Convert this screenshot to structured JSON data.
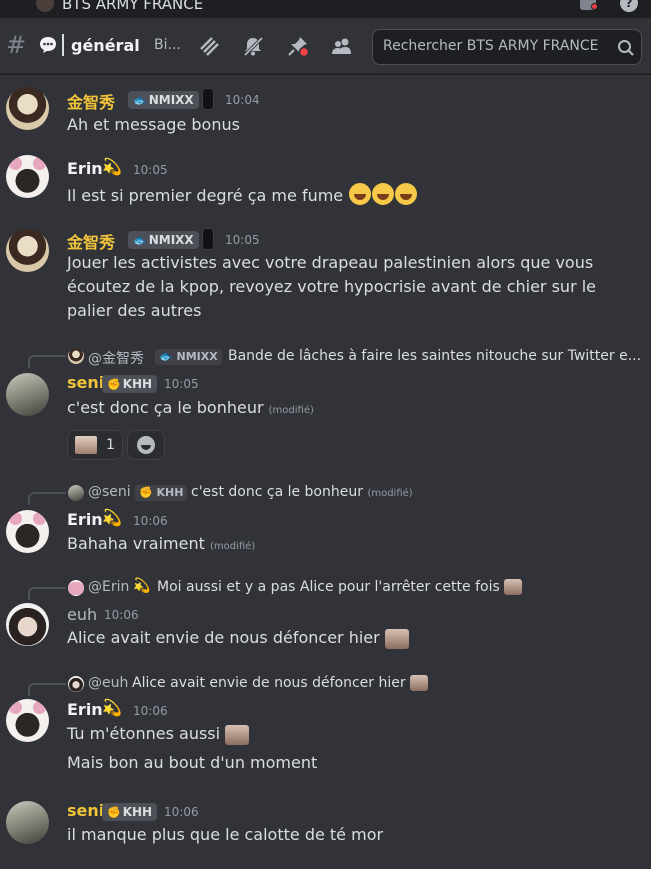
{
  "window": {
    "server_name": "BTS ARMY FRANCE"
  },
  "header": {
    "channel_name": "général",
    "topic_truncated": "Bi...",
    "search_placeholder": "Rechercher BTS ARMY FRANCE",
    "icons": [
      "threads-icon",
      "mute-bell-icon",
      "pinned-icon",
      "members-icon",
      "search-icon"
    ]
  },
  "colors": {
    "background": "#313338",
    "gold_name": "#f0c43a",
    "tag_bg": "#4e5058",
    "notification_red": "#f23f43"
  },
  "messages": [
    {
      "author": "金智秀",
      "tag": "NMIXX",
      "time": "10:04",
      "text": "Ah et message bonus"
    },
    {
      "author": "Erin",
      "time": "10:05",
      "text": "Il est si premier degré ça me fume"
    },
    {
      "author": "金智秀",
      "tag": "NMIXX",
      "time": "10:05",
      "text": "Jouer les activistes avec votre drapeau palestinien alors que vous écoutez de la kpop, revoyez votre hypocrisie avant de chier sur le palier des autres"
    },
    {
      "reply": {
        "author": "@金智秀",
        "tag": "NMIXX",
        "text": "Bande de lâches à faire les saintes nitouche sur Twitter e..."
      },
      "author": "seni",
      "tag": "KHH",
      "time": "10:05",
      "text": "c'est donc ça le bonheur",
      "edited": "(modifié)",
      "reaction_count": "1"
    },
    {
      "reply": {
        "author": "@seni",
        "tag": "KHH",
        "text": "c'est donc ça le bonheur",
        "edited": "(modifié)"
      },
      "author": "Erin",
      "time": "10:06",
      "text": "Bahaha vraiment",
      "edited": "(modifié)"
    },
    {
      "reply": {
        "author": "@Erin",
        "text": "Moi aussi et y a pas Alice pour l'arrêter cette fois"
      },
      "author": "euh",
      "time": "10:06",
      "text": "Alice avait envie de nous défoncer hier"
    },
    {
      "reply": {
        "author": "@euh",
        "text": "Alice avait envie de nous défoncer hier"
      },
      "author": "Erin",
      "time": "10:06",
      "text": "Tu m'étonnes aussi",
      "text2": "Mais bon au bout d'un moment"
    },
    {
      "author": "seni",
      "tag": "KHH",
      "time": "10:06",
      "text": "il manque plus que le calotte de té mor"
    }
  ]
}
